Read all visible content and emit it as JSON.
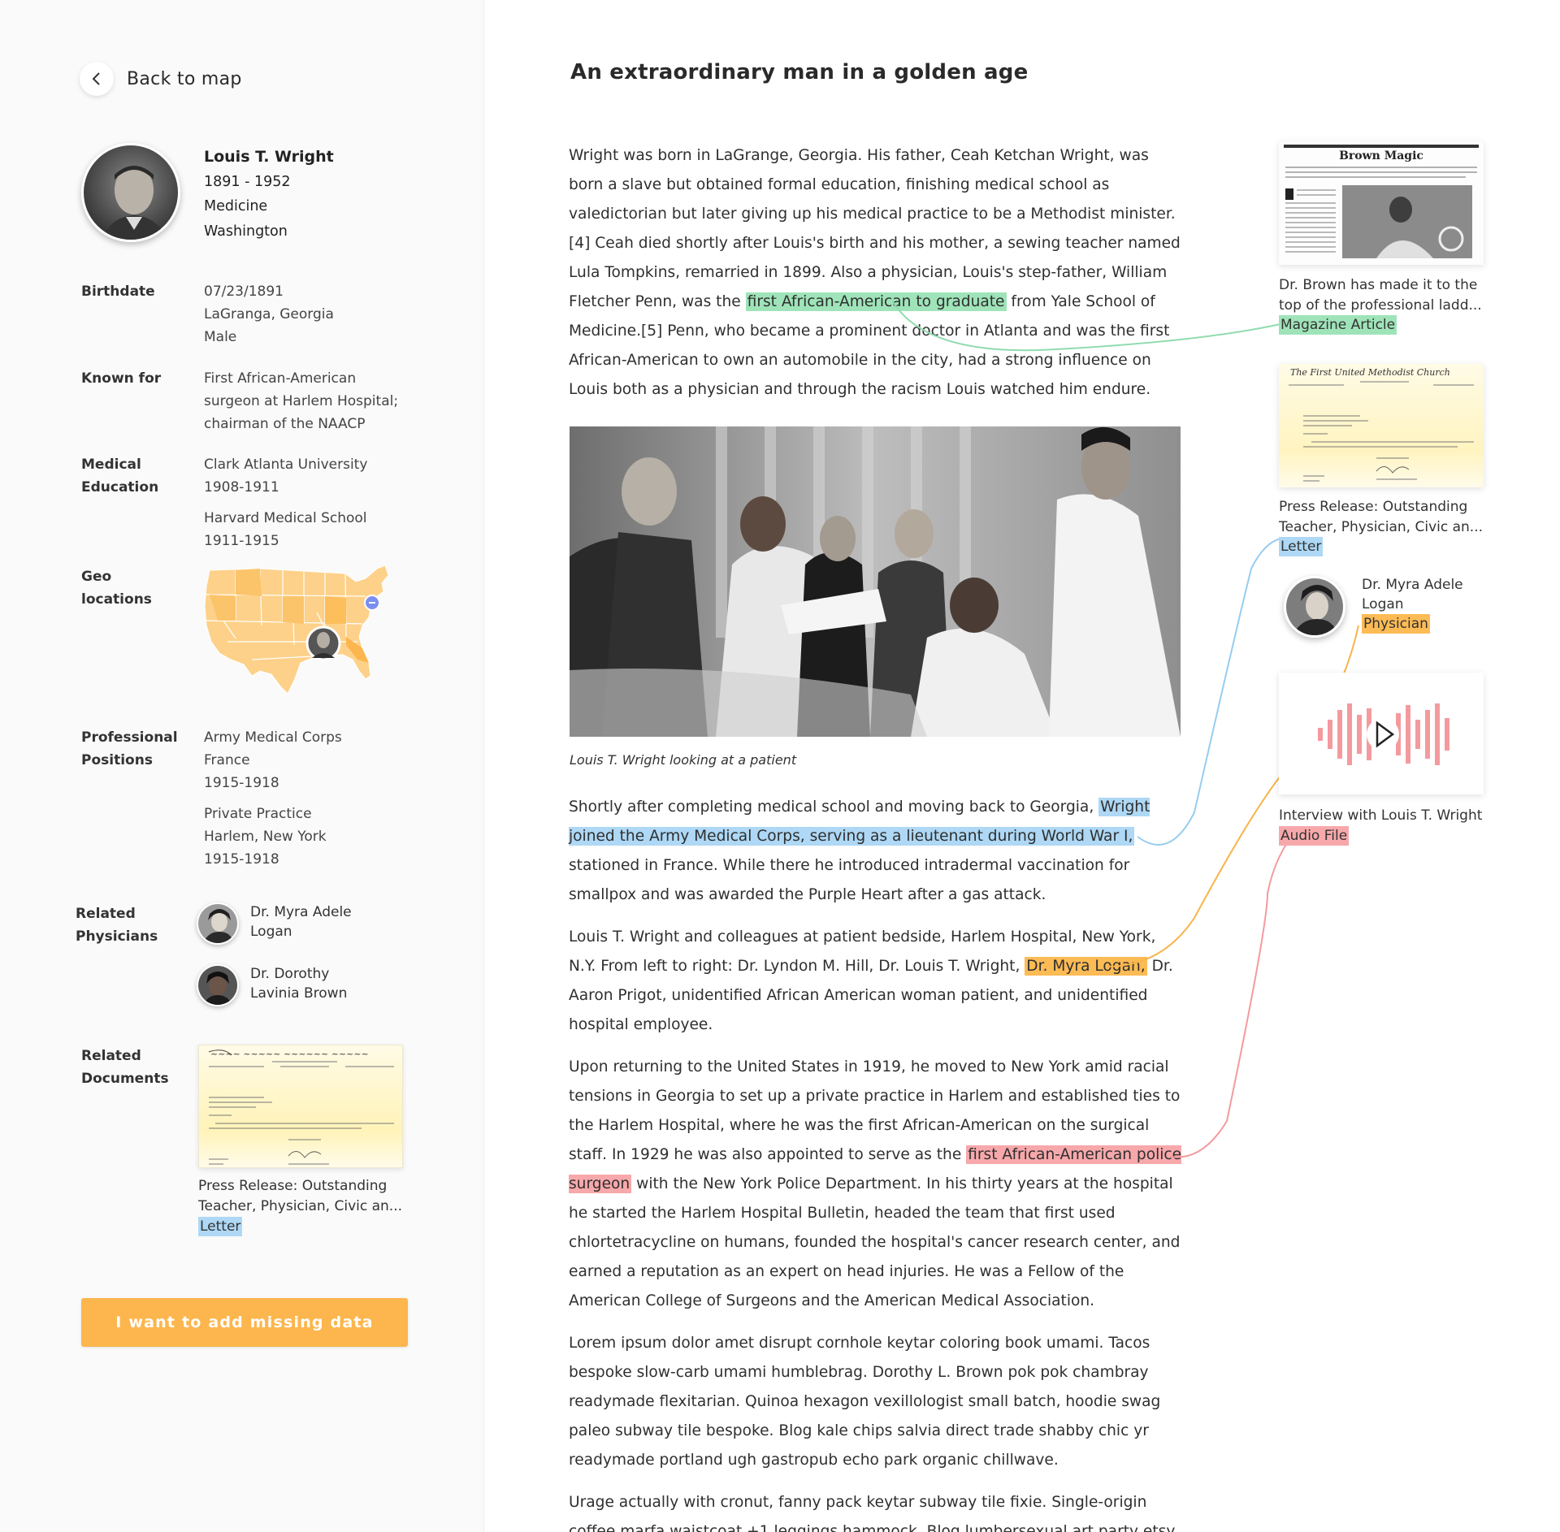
{
  "nav": {
    "back_label": "Back to map"
  },
  "profile": {
    "name": "Louis T. Wright",
    "years": "1891 - 1952",
    "field": "Medicine",
    "location": "Washington"
  },
  "details": {
    "birthdate": {
      "label": "Birthdate",
      "lines": [
        "07/23/1891",
        "LaGranga, Georgia",
        "Male"
      ]
    },
    "known_for": {
      "label": "Known for",
      "lines": [
        "First African-American",
        "surgeon at Harlem Hospital;",
        "chairman of the NAACP"
      ]
    },
    "medical_education": {
      "label_lines": [
        "Medical",
        "Education"
      ],
      "entries": [
        {
          "line1": "Clark Atlanta University",
          "line2": "1908-1911"
        },
        {
          "line1": "Harvard Medical School",
          "line2": "1911-1915"
        }
      ]
    },
    "geo_locations": {
      "label_lines": [
        "Geo",
        "locations"
      ]
    },
    "professional_positions": {
      "label_lines": [
        "Professional",
        "Positions"
      ],
      "entries": [
        {
          "line1": "Army Medical Corps",
          "line2": "France",
          "line3": "1915-1918"
        },
        {
          "line1": "Private Practice",
          "line2": "Harlem, New York",
          "line3": "1915-1918"
        }
      ]
    },
    "related_physicians": {
      "label_lines": [
        "Related",
        "Physicians"
      ],
      "items": [
        {
          "line1": "Dr. Myra Adele",
          "line2": "Logan"
        },
        {
          "line1": "Dr. Dorothy",
          "line2": "Lavinia Brown"
        }
      ]
    },
    "related_documents": {
      "label_lines": [
        "Related",
        "Documents"
      ],
      "doc": {
        "title_line1": "Press Release: Outstanding",
        "title_line2": "Teacher, Physician, Civic an...",
        "tag": "Letter"
      }
    }
  },
  "cta_label": "I want to add missing data",
  "article": {
    "title": "An extraordinary man in a golden age",
    "p1_a": "Wright was born in LaGrange, Georgia. His father, Ceah Ketchan Wright, was born a slave but obtained formal education, finishing medical school as valedictorian but later giving up his medical practice to be a Methodist minister.[4] Ceah died shortly after Louis's birth and his mother, a sewing teacher named Lula Tompkins, remarried in 1899. Also a physician, Louis's step-father, William Fletcher Penn, was the ",
    "p1_hl": "first African-American to graduate",
    "p1_b": " from Yale School of Medicine.[5] Penn, who became a prominent doctor in Atlanta and was the first African-American to own an automobile in the city, had a strong influence on Louis both as a physician and through the racism Louis watched him endure.",
    "photo_caption": "Louis T. Wright looking at a patient",
    "p2_a": "Shortly after completing medical school and moving back to Georgia, ",
    "p2_hl": "Wright joined the Army Medical Corps, serving as a lieutenant during World War I,",
    "p2_b": " stationed in France. While there he introduced intradermal vaccination for smallpox and was awarded the Purple Heart after a gas attack.",
    "p3_a": "Louis T. Wright and colleagues at patient bedside, Harlem Hospital, New York, N.Y. From left to right: Dr. Lyndon M. Hill, Dr. Louis T. Wright, ",
    "p3_hl": "Dr. Myra Logan,",
    "p3_b": " Dr. Aaron Prigot, unidentified African American woman patient, and unidentified hospital employee.",
    "p4_a": "Upon returning to the United States in 1919, he moved to New York amid racial tensions in Georgia to set up a private practice in Harlem and established ties to the Harlem Hospital, where he was the first African-American on the surgical staff. In 1929 he was also appointed to serve as the ",
    "p4_hl": "first African-American police surgeon",
    "p4_b": " with the New York Police Department. In his thirty years at the hospital he started the Harlem Hospital Bulletin, headed the team that first used chlortetracycline on humans, founded the hospital's cancer research center, and earned a reputation as an expert on head injuries. He was a Fellow of the American College of Surgeons and the American Medical Association.",
    "p5": "Lorem ipsum dolor amet disrupt cornhole keytar coloring book umami. Tacos bespoke slow-carb umami humblebrag. Dorothy L. Brown pok pok chambray readymade flexitarian. Quinoa hexagon vexillologist small batch, hoodie swag paleo subway tile bespoke. Blog kale chips salvia direct trade shabby chic yr readymade portland ugh gastropub echo park organic chillwave.",
    "p6": "Urage actually with cronut, fanny pack keytar subway tile fixie. Single-origin coffee marfa waistcoat +1 leggings hammock. Blog lumbersexual art party etsy"
  },
  "sources": {
    "magazine": {
      "headline": "Brown Magic",
      "title_line1": "Dr. Brown has made it to the",
      "title_line2": "top of the professional ladd...",
      "tag": "Magazine Article"
    },
    "press": {
      "title_line1": "Press Release: Outstanding",
      "title_line2": "Teacher, Physician, Civic an...",
      "tag": "Letter",
      "letterhead": "The First United Methodist Church"
    },
    "physician": {
      "line1": "Dr. Myra Adele",
      "line2": "Logan",
      "tag": "Physician"
    },
    "audio": {
      "title": "Interview with Louis T. Wright",
      "tag": "Audio File"
    }
  },
  "colors": {
    "accent_orange": "#fcb64d",
    "tag_green": "#9fe4b9",
    "tag_blue": "#aed8f5",
    "tag_orange": "#fcbb55",
    "tag_red": "#f7a8ab",
    "map_fill": "#fdd189"
  },
  "icons": {
    "back": "chevron-left-icon",
    "play": "play-icon",
    "map_pin": "location-pin-icon"
  }
}
